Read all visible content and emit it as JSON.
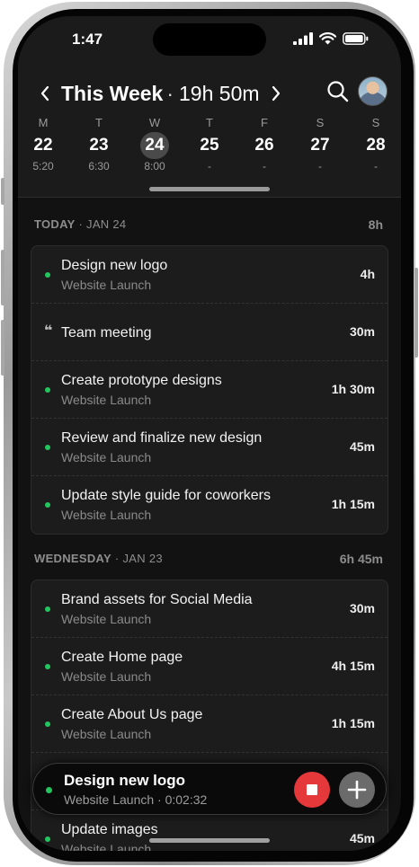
{
  "status_bar": {
    "time": "1:47"
  },
  "header": {
    "title": "This Week",
    "separator": "·",
    "total": "19h 50m"
  },
  "week_days": [
    {
      "letter": "M",
      "date": "22",
      "hours": "5:20",
      "selected": false
    },
    {
      "letter": "T",
      "date": "23",
      "hours": "6:30",
      "selected": false
    },
    {
      "letter": "W",
      "date": "24",
      "hours": "8:00",
      "selected": true
    },
    {
      "letter": "T",
      "date": "25",
      "hours": "-",
      "selected": false
    },
    {
      "letter": "F",
      "date": "26",
      "hours": "-",
      "selected": false
    },
    {
      "letter": "S",
      "date": "27",
      "hours": "-",
      "selected": false
    },
    {
      "letter": "S",
      "date": "28",
      "hours": "-",
      "selected": false
    }
  ],
  "sections": [
    {
      "label": "TODAY",
      "date": "JAN 24",
      "total": "8h",
      "entries": [
        {
          "title": "Design new logo",
          "project": "Website Launch",
          "duration": "4h",
          "icon": "green-dot"
        },
        {
          "title": "Team meeting",
          "project": "",
          "duration": "30m",
          "icon": "quote-icon"
        },
        {
          "title": "Create prototype designs",
          "project": "Website Launch",
          "duration": "1h 30m",
          "icon": "green-dot"
        },
        {
          "title": "Review and finalize new design",
          "project": "Website Launch",
          "duration": "45m",
          "icon": "green-dot"
        },
        {
          "title": "Update style guide for coworkers",
          "project": "Website Launch",
          "duration": "1h 15m",
          "icon": "green-dot"
        }
      ]
    },
    {
      "label": "WEDNESDAY",
      "date": "JAN 23",
      "total": "6h 45m",
      "entries": [
        {
          "title": "Brand assets for Social Media",
          "project": "Website Launch",
          "duration": "30m",
          "icon": "green-dot"
        },
        {
          "title": "Create Home page",
          "project": "Website Launch",
          "duration": "4h 15m",
          "icon": "green-dot"
        },
        {
          "title": "Create About Us page",
          "project": "Website Launch",
          "duration": "1h 15m",
          "icon": "green-dot"
        },
        {
          "title": "",
          "project": "",
          "duration": "",
          "icon": "green-dot"
        },
        {
          "title": "Update images",
          "project": "Website Launch",
          "duration": "45m",
          "icon": "green-dot"
        }
      ]
    }
  ],
  "running_timer": {
    "title": "Design new logo",
    "project": "Website Launch",
    "separator": "·",
    "elapsed": "0:02:32"
  },
  "colors": {
    "accent_green": "#22c55e",
    "stop_red": "#e5383b",
    "background": "#121212",
    "card": "#1c1c1c"
  }
}
